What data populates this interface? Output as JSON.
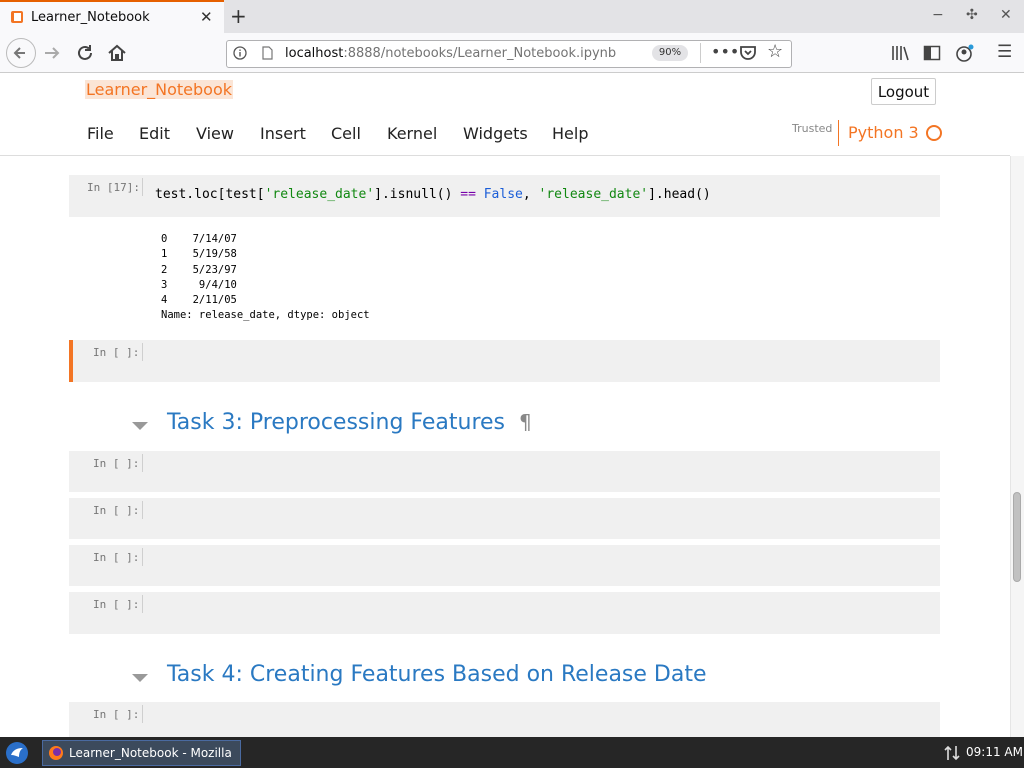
{
  "browser": {
    "tab_title": "Learner_Notebook",
    "url_host": "localhost",
    "url_path": ":8888/notebooks/Learner_Notebook.ipynb",
    "zoom": "90%"
  },
  "notebook": {
    "logo": "Learner_Notebook",
    "logout": "Logout",
    "menu": [
      "File",
      "Edit",
      "View",
      "Insert",
      "Cell",
      "Kernel",
      "Widgets",
      "Help"
    ],
    "trusted": "Trusted",
    "kernel": "Python 3"
  },
  "cells": {
    "c17": {
      "prompt": "In [17]:",
      "code_a": "test.loc[test[",
      "code_s1": "'release_date'",
      "code_b": "].isnull() ",
      "code_op": "==",
      "code_sp": " ",
      "code_kw": "False",
      "code_c": ", ",
      "code_s2": "'release_date'",
      "code_d": "].head()",
      "output": [
        "0    7/14/07",
        "1    5/19/58",
        "2    5/23/97",
        "3     9/4/10",
        "4    2/11/05",
        "Name: release_date, dtype: object"
      ]
    },
    "empty_prompt": "In [ ]:"
  },
  "headings": {
    "task3": "Task 3: Preprocessing Features",
    "pilcrow": "¶",
    "task4": "Task 4: Creating Features Based on Release Date"
  },
  "taskbar": {
    "window": "Learner_Notebook - Mozilla ...",
    "clock": "09:11 AM"
  }
}
